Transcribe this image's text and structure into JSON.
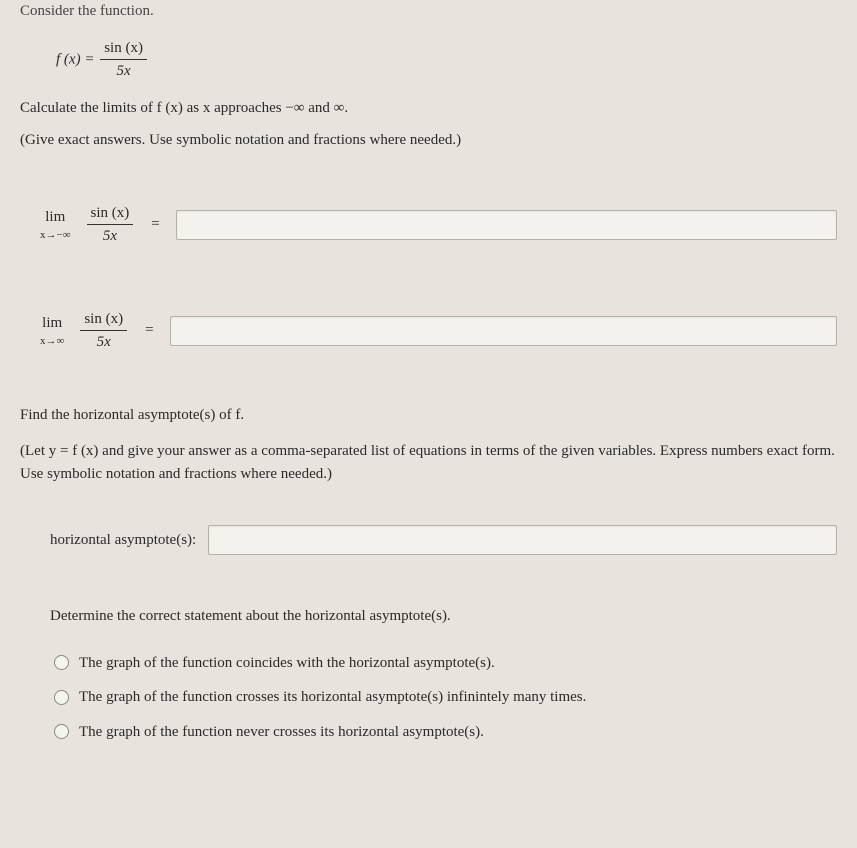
{
  "intro": "Consider the function.",
  "func_lhs": "f (x) = ",
  "frac": {
    "num": "sin (x)",
    "den": "5x"
  },
  "calc_line": "Calculate the limits of f (x) as x approaches −∞ and ∞.",
  "give_line": "(Give exact answers. Use symbolic notation and fractions where needed.)",
  "lim1": {
    "lim": "lim",
    "sub": "x→−∞"
  },
  "lim2": {
    "lim": "lim",
    "sub": "x→∞"
  },
  "limfrac": {
    "num": "sin (x)",
    "den": "5x"
  },
  "equals": "=",
  "find_ha": "Find the horizontal asymptote(s) of f.",
  "ha_instr": "(Let y = f (x) and give your answer as a comma-separated list of equations in terms of the given variables. Express numbers exact form. Use symbolic notation and fractions where needed.)",
  "ha_label": "horizontal asymptote(s):",
  "determine": "Determine the correct statement about the horizontal asymptote(s).",
  "options": [
    "The graph of the function coincides with the horizontal asymptote(s).",
    "The graph of the function crosses its horizontal asymptote(s) infinintely many times.",
    "The graph of the function never crosses its horizontal asymptote(s)."
  ]
}
